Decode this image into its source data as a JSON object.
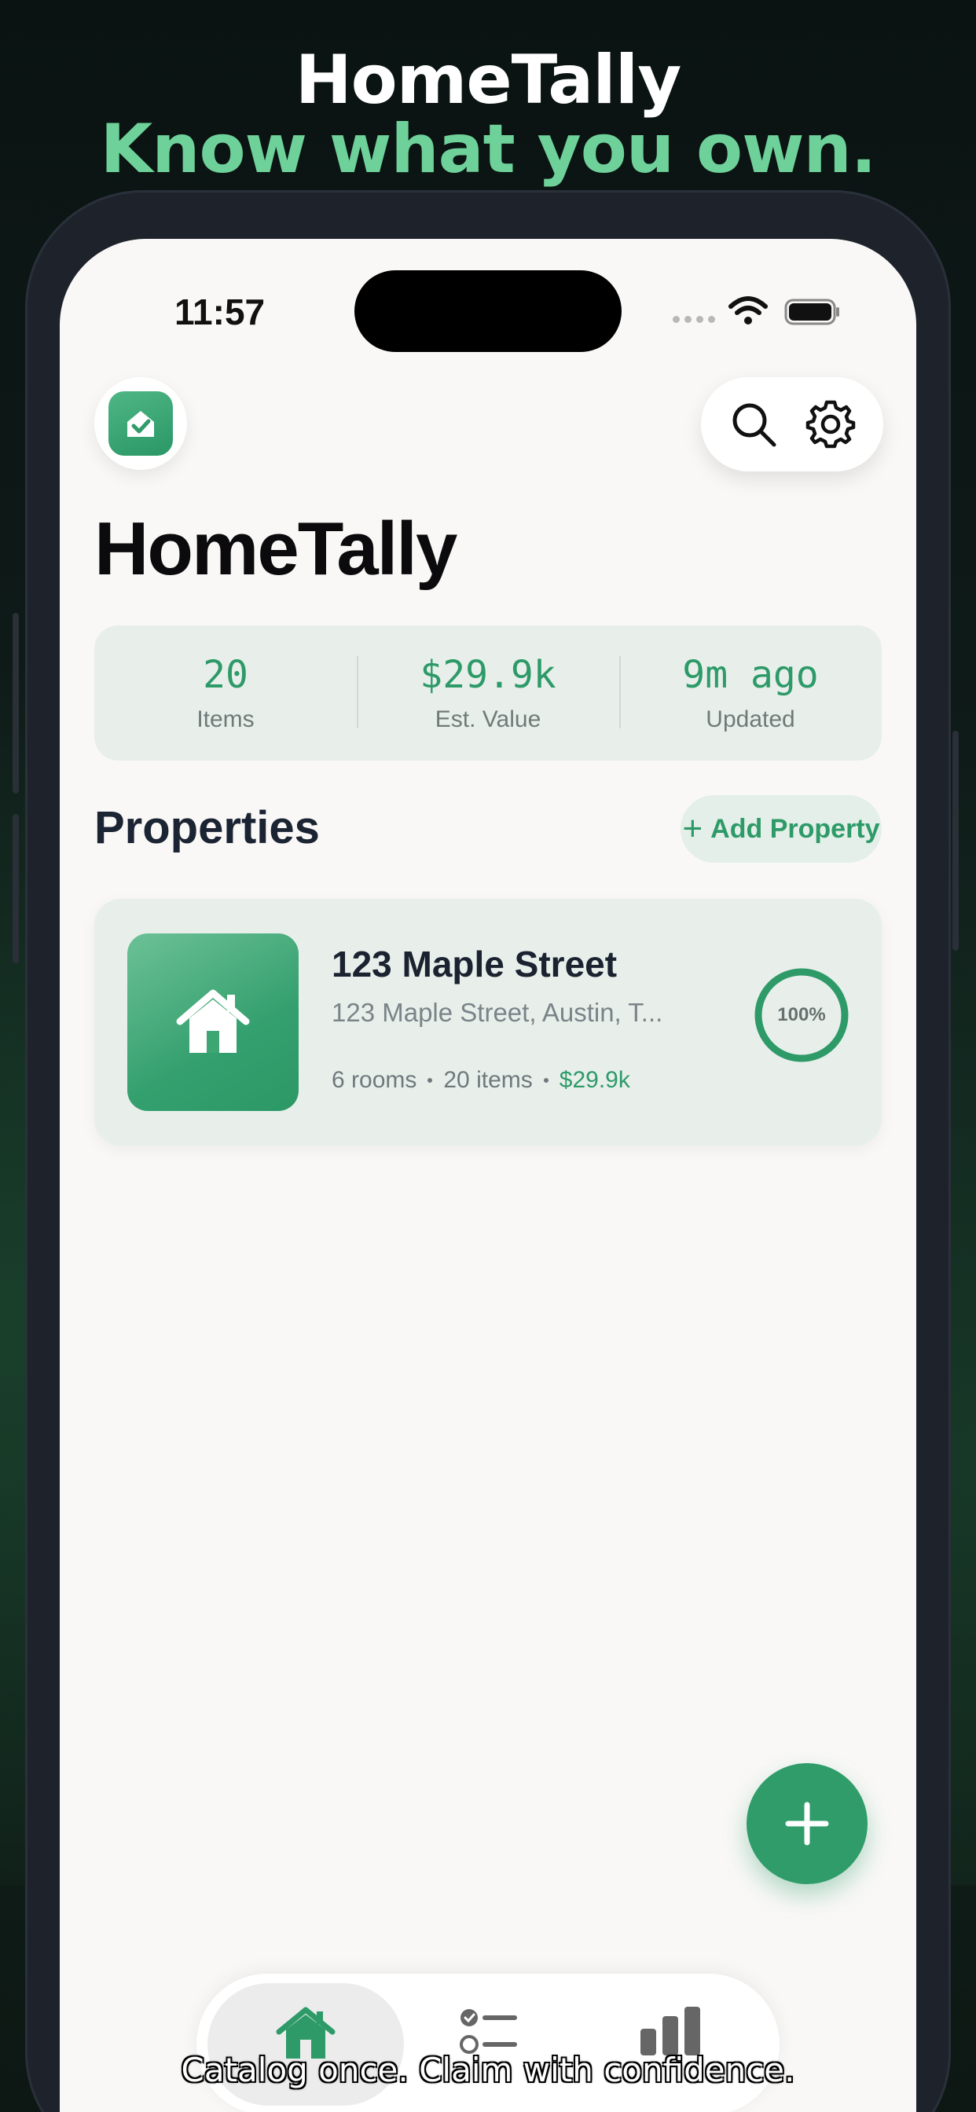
{
  "marketing": {
    "headline": "HomeTally",
    "tagline": "Know what you own.",
    "caption": "Catalog once. Claim with confidence."
  },
  "status_bar": {
    "time": "11:57"
  },
  "header": {
    "title": "HomeTally",
    "icons": [
      "house-check-icon",
      "search-icon",
      "gear-icon"
    ]
  },
  "stats": [
    {
      "value": "20",
      "label": "Items"
    },
    {
      "value": "$29.9k",
      "label": "Est. Value"
    },
    {
      "value": "9m ago",
      "label": "Updated"
    }
  ],
  "properties": {
    "section_title": "Properties",
    "add_label": "Add Property",
    "items": [
      {
        "name": "123 Maple Street",
        "address": "123 Maple Street, Austin, T...",
        "rooms": "6 rooms",
        "items": "20 items",
        "value": "$29.9k",
        "completion_label": "100%",
        "completion": 1.0
      }
    ]
  },
  "tabs": [
    {
      "icon": "house-icon",
      "active": true
    },
    {
      "icon": "checklist-icon",
      "active": false
    },
    {
      "icon": "bar-chart-icon",
      "active": false
    }
  ],
  "colors": {
    "accent": "#2d9a68",
    "tagline": "#6fd19a",
    "card_bg": "#e8efeb"
  }
}
